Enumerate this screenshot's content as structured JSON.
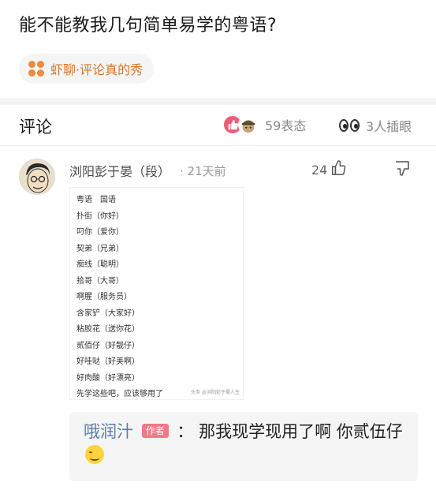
{
  "question": {
    "title": "能不能教我几句简单易学的粤语?"
  },
  "topic": {
    "label": "虾聊·评论真的秀"
  },
  "comments_header": {
    "label": "评论",
    "reactions_count": "59表态",
    "plus_count": "3人插眼"
  },
  "comment": {
    "author": "浏阳彭于晏（段）",
    "time": "· 21天前",
    "likes": "24",
    "image_rows": [
      "粤语　国语",
      "扑街（你好）",
      "叼你（爱你）",
      "契弟（兄弟）",
      "痴线（聪明）",
      "拾哥（大哥）",
      "啊腥（服务员）",
      "含家铲（大家好）",
      "粘胶花（送你花）",
      "贰佰仔（好靓仔）",
      "好哇哒（好美啊）",
      "好肉酸（好漂亮）",
      "先学这些吧，应该够用了"
    ],
    "image_watermark": "头条 @浏阳彭于晏人生"
  },
  "reply": {
    "author": "哦润汁",
    "badge": "作者",
    "separator": "：",
    "text": "那我现学现用了啊 你贰伍仔"
  },
  "colors": {
    "accent_orange": "#f08a3c",
    "reply_name": "#5b7da8",
    "badge": "#f07a86",
    "like_pink": "#f05b7a"
  }
}
